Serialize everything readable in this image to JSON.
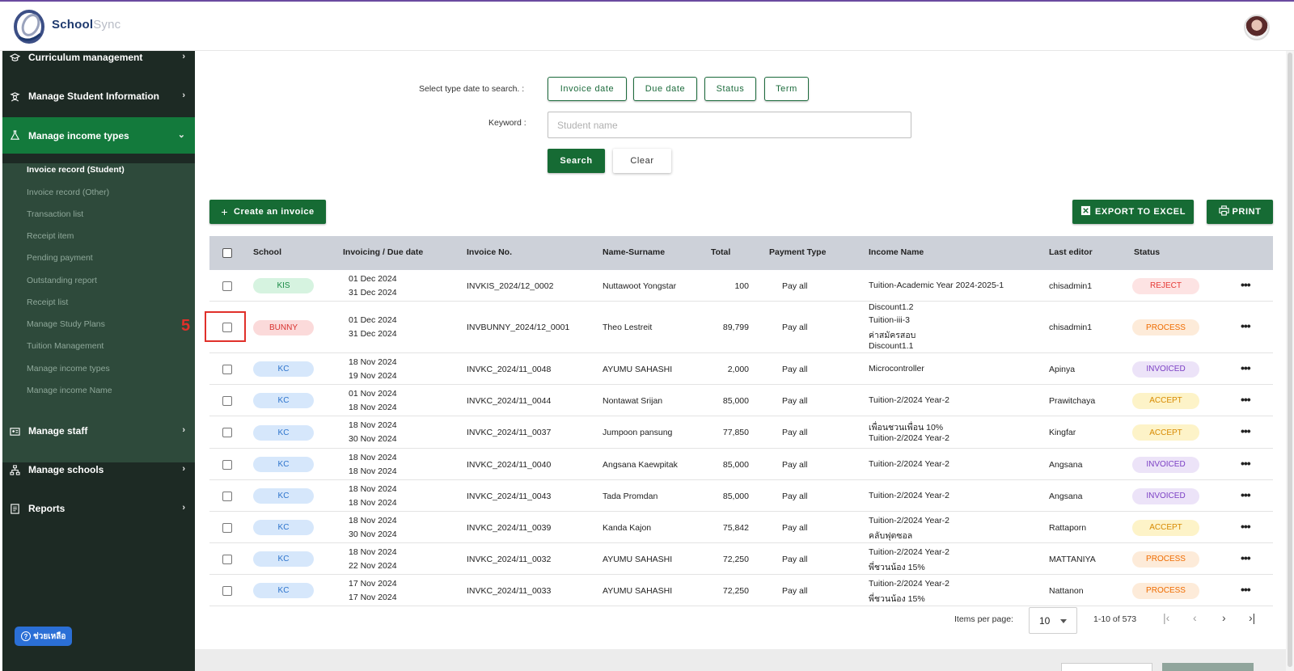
{
  "app": {
    "logo_brand": "School",
    "logo_brand_sub": "Sync"
  },
  "sidebar": {
    "items": [
      {
        "label": "Curriculum management",
        "icon": "graduation-cap-icon"
      },
      {
        "label": "Manage Student Information",
        "icon": "student-icon"
      },
      {
        "label": "Manage income types",
        "icon": "flask-icon",
        "expanded": true
      },
      {
        "label": "Manage staff",
        "icon": "id-card-icon"
      },
      {
        "label": "Manage schools",
        "icon": "sitemap-icon"
      },
      {
        "label": "Reports",
        "icon": "report-icon"
      }
    ],
    "submenu": [
      "Invoice record (Student)",
      "Invoice record (Other)",
      "Transaction list",
      "Receipt item",
      "Pending payment",
      "Outstanding report",
      "Receipt list",
      "Manage Study Plans",
      "Tuition Management",
      "Manage income types",
      "Manage income Name"
    ],
    "help_label": "ช่วยเหลือ"
  },
  "search": {
    "date_type_label": "Select type date to search. :",
    "filters": [
      "Invoice date",
      "Due date",
      "Status",
      "Term"
    ],
    "keyword_label": "Keyword :",
    "keyword_placeholder": "Student name",
    "search_label": "Search",
    "clear_label": "Clear"
  },
  "actions": {
    "create_label": "Create an invoice",
    "export_label": "EXPORT TO EXCEL",
    "print_label": "PRINT"
  },
  "annotation": {
    "step_number": "5"
  },
  "table": {
    "headers": [
      "School",
      "Invoicing / Due date",
      "Invoice No.",
      "Name-Surname",
      "Total",
      "Payment Type",
      "Income Name",
      "Last editor",
      "Status"
    ],
    "rows": [
      {
        "school": "KIS",
        "school_color": "green",
        "invoice_date": "01 Dec 2024",
        "due_date": "31 Dec 2024",
        "invoice_no": "INVKIS_2024/12_0002",
        "name": "Nuttawoot Yongstar",
        "total": "100",
        "payment": "Pay all",
        "income": [
          "Tuition-Academic Year 2024-2025-1"
        ],
        "editor": "chisadmin1",
        "status": "REJECT"
      },
      {
        "school": "BUNNY",
        "school_color": "red",
        "invoice_date": "01 Dec 2024",
        "due_date": "31 Dec 2024",
        "invoice_no": "INVBUNNY_2024/12_0001",
        "name": "Theo Lestreit",
        "total": "89,799",
        "payment": "Pay all",
        "income": [
          "Discount1.2",
          "Tuition-iii-3",
          "ค่าสมัครสอบ",
          "Discount1.1"
        ],
        "editor": "chisadmin1",
        "status": "PROCESS"
      },
      {
        "school": "KC",
        "school_color": "blue",
        "invoice_date": "18 Nov 2024",
        "due_date": "19 Nov 2024",
        "invoice_no": "INVKC_2024/11_0048",
        "name": "AYUMU SAHASHI",
        "total": "2,000",
        "payment": "Pay all",
        "income": [
          "Microcontroller"
        ],
        "editor": "Apinya",
        "status": "INVOICED"
      },
      {
        "school": "KC",
        "school_color": "blue",
        "invoice_date": "01 Nov 2024",
        "due_date": "18 Nov 2024",
        "invoice_no": "INVKC_2024/11_0044",
        "name": "Nontawat Srijan",
        "total": "85,000",
        "payment": "Pay all",
        "income": [
          "Tuition-2/2024 Year-2"
        ],
        "editor": "Prawitchaya",
        "status": "ACCEPT"
      },
      {
        "school": "KC",
        "school_color": "blue",
        "invoice_date": "18 Nov 2024",
        "due_date": "30 Nov 2024",
        "invoice_no": "INVKC_2024/11_0037",
        "name": "Jumpoon pansung",
        "total": "77,850",
        "payment": "Pay all",
        "income": [
          "เพื่อนชวนเพื่อน 10%",
          "Tuition-2/2024 Year-2"
        ],
        "editor": "Kingfar",
        "status": "ACCEPT"
      },
      {
        "school": "KC",
        "school_color": "blue",
        "invoice_date": "18 Nov 2024",
        "due_date": "18 Nov 2024",
        "invoice_no": "INVKC_2024/11_0040",
        "name": "Angsana Kaewpitak",
        "total": "85,000",
        "payment": "Pay all",
        "income": [
          "Tuition-2/2024 Year-2"
        ],
        "editor": "Angsana",
        "status": "INVOICED"
      },
      {
        "school": "KC",
        "school_color": "blue",
        "invoice_date": "18 Nov 2024",
        "due_date": "18 Nov 2024",
        "invoice_no": "INVKC_2024/11_0043",
        "name": "Tada Promdan",
        "total": "85,000",
        "payment": "Pay all",
        "income": [
          "Tuition-2/2024 Year-2"
        ],
        "editor": "Angsana",
        "status": "INVOICED"
      },
      {
        "school": "KC",
        "school_color": "blue",
        "invoice_date": "18 Nov 2024",
        "due_date": "30 Nov 2024",
        "invoice_no": "INVKC_2024/11_0039",
        "name": "Kanda Kajon",
        "total": "75,842",
        "payment": "Pay all",
        "income": [
          "Tuition-2/2024 Year-2",
          "คลับฟุตซอล"
        ],
        "editor": "Rattaporn",
        "status": "ACCEPT"
      },
      {
        "school": "KC",
        "school_color": "blue",
        "invoice_date": "18 Nov 2024",
        "due_date": "22 Nov 2024",
        "invoice_no": "INVKC_2024/11_0032",
        "name": "AYUMU SAHASHI",
        "total": "72,250",
        "payment": "Pay all",
        "income": [
          "Tuition-2/2024 Year-2",
          "พี่ชวนน้อง 15%"
        ],
        "editor": "MATTANIYA",
        "status": "PROCESS"
      },
      {
        "school": "KC",
        "school_color": "blue",
        "invoice_date": "17 Nov 2024",
        "due_date": "17 Nov 2024",
        "invoice_no": "INVKC_2024/11_0033",
        "name": "AYUMU SAHASHI",
        "total": "72,250",
        "payment": "Pay all",
        "income": [
          "Tuition-2/2024 Year-2",
          "พี่ชวนน้อง 15%"
        ],
        "editor": "Nattanon",
        "status": "PROCESS"
      }
    ]
  },
  "pagination": {
    "items_per_page_label": "Items per page:",
    "items_per_page": "10",
    "range": "1-10 of 573"
  },
  "colors": {
    "primary_green": "#166b34",
    "sidebar_bg": "#1d2a24",
    "sidebar_active": "#137a3c",
    "status_reject": "#e53935",
    "status_process": "#ef6c00",
    "status_invoiced": "#7b3fc4",
    "status_accept": "#e39a00"
  }
}
